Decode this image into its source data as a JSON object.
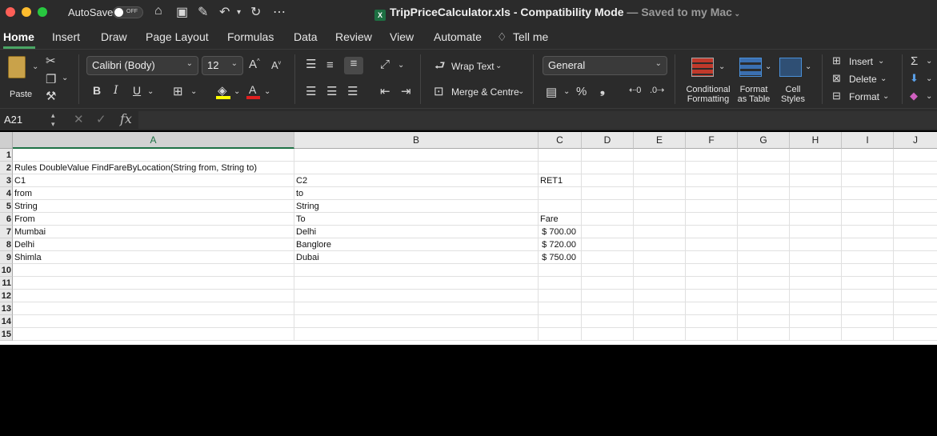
{
  "titlebar": {
    "autosave_label": "AutoSave",
    "autosave_state": "OFF",
    "file_name": "TripPriceCalculator.xls",
    "separator": " - ",
    "mode": "Compatibility Mode",
    "saved_status": " — Saved to my Mac"
  },
  "tabs": [
    "Home",
    "Insert",
    "Draw",
    "Page Layout",
    "Formulas",
    "Data",
    "Review",
    "View",
    "Automate",
    "Tell me"
  ],
  "ribbon": {
    "paste": "Paste",
    "font_name": "Calibri (Body)",
    "font_size": "12",
    "bold": "B",
    "italic": "I",
    "underline": "U",
    "wrap_text": "Wrap Text",
    "merge_centre": "Merge & Centre",
    "number_format": "General",
    "conditional_formatting": [
      "Conditional",
      "Formatting"
    ],
    "format_as_table": [
      "Format",
      "as Table"
    ],
    "cell_styles": [
      "Cell",
      "Styles"
    ],
    "insert": "Insert",
    "delete": "Delete",
    "format": "Format"
  },
  "formula_bar": {
    "name_box": "A21",
    "fx": "fx",
    "formula": ""
  },
  "sheet": {
    "columns": [
      "A",
      "B",
      "C",
      "D",
      "E",
      "F",
      "G",
      "H",
      "I",
      "J"
    ],
    "rows": [
      "1",
      "2",
      "3",
      "4",
      "5",
      "6",
      "7",
      "8",
      "9",
      "10",
      "11",
      "12",
      "13",
      "14",
      "15"
    ],
    "cells": {
      "A2": "Rules DoubleValue FindFareByLocation(String from, String to)",
      "A3": "C1",
      "B3": "C2",
      "C3": "RET1",
      "A4": "from",
      "B4": "to",
      "A5": "String",
      "B5": "String",
      "A6": "From",
      "B6": "To",
      "C6": "Fare",
      "A7": "Mumbai",
      "B7": "Delhi",
      "C7": "$ 700.00",
      "A8": "Delhi",
      "B8": "Banglore",
      "C8": "$ 720.00",
      "A9": "Shimla",
      "B9": "Dubai",
      "C9": "$ 750.00"
    }
  }
}
